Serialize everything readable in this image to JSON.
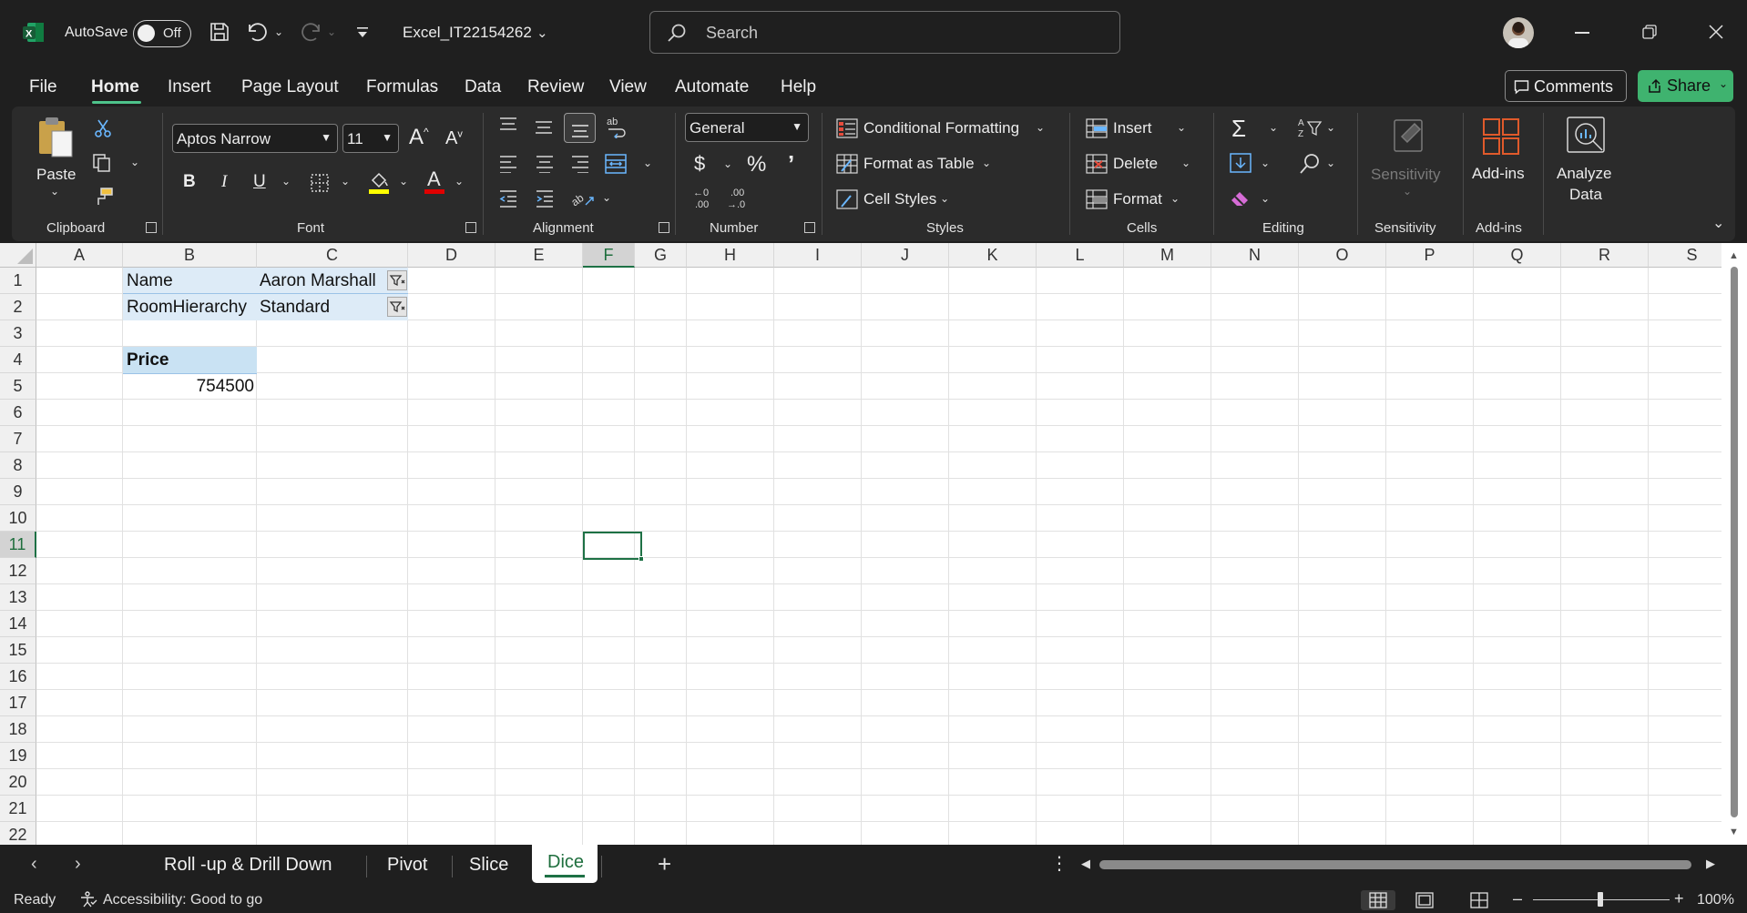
{
  "app": {
    "autosave_label": "AutoSave",
    "autosave_state": "Off",
    "filename": "Excel_IT22154262",
    "search_placeholder": "Search",
    "brand_color": "#1e7145",
    "accent_color": "#4ec38b"
  },
  "menu": {
    "items": [
      "File",
      "Home",
      "Insert",
      "Page Layout",
      "Formulas",
      "Data",
      "Review",
      "View",
      "Automate",
      "Help"
    ],
    "active": "Home",
    "comments_label": "Comments",
    "share_label": "Share"
  },
  "ribbon": {
    "clipboard": {
      "paste_label": "Paste",
      "group_label": "Clipboard"
    },
    "font": {
      "font_name": "Aptos Narrow",
      "font_size": "11",
      "group_label": "Font",
      "highlight_color": "#ffff00",
      "font_color": "#e00000"
    },
    "alignment": {
      "group_label": "Alignment"
    },
    "number": {
      "format": "General",
      "group_label": "Number"
    },
    "styles": {
      "conditional_formatting": "Conditional Formatting",
      "format_as_table": "Format as Table",
      "cell_styles": "Cell Styles",
      "group_label": "Styles"
    },
    "cells": {
      "insert": "Insert",
      "delete": "Delete",
      "format": "Format",
      "group_label": "Cells"
    },
    "editing": {
      "group_label": "Editing"
    },
    "sensitivity": {
      "label": "Sensitivity",
      "group_label": "Sensitivity"
    },
    "addins": {
      "label": "Add-ins",
      "group_label": "Add-ins"
    },
    "analyze": {
      "line1": "Analyze",
      "line2": "Data"
    }
  },
  "sheet": {
    "columns": [
      "A",
      "B",
      "C",
      "D",
      "E",
      "F",
      "G",
      "H",
      "I",
      "J",
      "K",
      "L",
      "M",
      "N",
      "O",
      "P",
      "Q",
      "R",
      "S"
    ],
    "rows": [
      "1",
      "2",
      "3",
      "4",
      "5",
      "6",
      "7",
      "8",
      "9",
      "10",
      "11",
      "12",
      "13",
      "14",
      "15",
      "16",
      "17",
      "18",
      "19",
      "20",
      "21",
      "22"
    ],
    "selected_column": "F",
    "selected_row": "11",
    "cells": {
      "B1": "Name",
      "C1": "Aaron Marshall",
      "B2": "RoomHierarchy",
      "C2": "Standard",
      "B4": "Price",
      "B5": "754500"
    },
    "pivot_header_color": "#ddebf7",
    "pivot_title_color": "#c9e2f3"
  },
  "tabs": {
    "items": [
      "Roll -up &  Drill Down",
      "Pivot",
      "Slice"
    ],
    "active": "Dice"
  },
  "status": {
    "ready": "Ready",
    "accessibility": "Accessibility: Good to go",
    "zoom": "100%"
  }
}
